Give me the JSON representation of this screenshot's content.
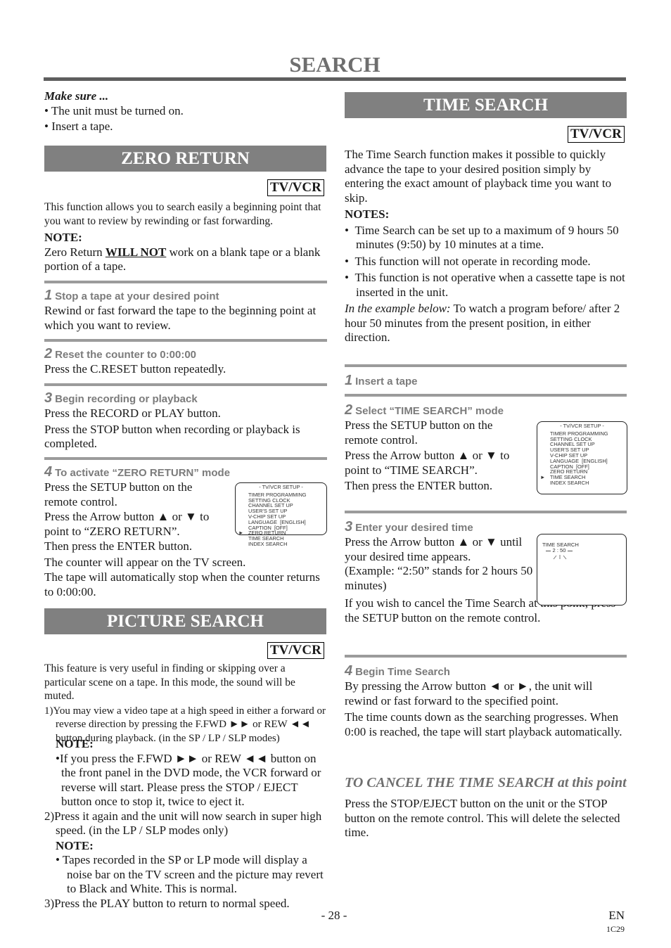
{
  "page": {
    "title": "SEARCH",
    "page_number": "- 28 -",
    "language": "EN",
    "code": "1C29"
  },
  "make_sure": {
    "heading": "Make sure ...",
    "items": [
      "The unit must be turned on.",
      "Insert a tape."
    ]
  },
  "zero_return": {
    "title": "ZERO RETURN",
    "badge": "TV/VCR",
    "intro": "This function allows you to search easily a beginning point that you want to review by rewinding or fast forwarding.",
    "note_label": "NOTE:",
    "note_pre": "Zero Return ",
    "note_emph": "WILL NOT",
    "note_post": " work on a blank tape or a blank portion of a tape.",
    "steps": [
      {
        "num": "1",
        "title": "Stop a tape at your desired point",
        "lines": [
          "Rewind or fast forward the tape to the beginning point at which you want to review."
        ]
      },
      {
        "num": "2",
        "title": "Reset the counter to 0:00:00",
        "lines": [
          "Press the C.RESET button repeatedly."
        ]
      },
      {
        "num": "3",
        "title": "Begin recording or playback",
        "lines": [
          "Press the RECORD or PLAY button.",
          "Press the STOP button when recording or playback is completed."
        ]
      },
      {
        "num": "4",
        "title": "To activate “ZERO RETURN” mode",
        "lines": [
          "Press the SETUP button on the remote control.",
          "Press the Arrow button ▲ or ▼ to point to “ZERO RETURN”.",
          "Then press the ENTER button.",
          "The counter will appear on the TV screen.",
          "The tape will automatically stop when the counter returns to 0:00:00."
        ]
      }
    ],
    "osd": {
      "title": "- TV/VCR SETUP -",
      "items": [
        "TIMER PROGRAMMING",
        "SETTING CLOCK",
        "CHANNEL SET UP",
        "USER'S SET UP",
        "V-CHIP SET UP",
        "LANGUAGE  [ENGLISH]",
        "CAPTION  [OFF]",
        "ZERO RETURN",
        "TIME SEARCH",
        "INDEX SEARCH"
      ],
      "selected": "ZERO RETURN",
      "cursor_glyph": "►"
    }
  },
  "picture_search": {
    "title": "PICTURE SEARCH",
    "badge": "TV/VCR",
    "intro": "This feature is very useful in finding or skipping over a particular scene on a tape. In this mode, the sound will be muted.",
    "item1": "1)You may view a video tape at a high speed in either a forward or reverse direction by pressing the F.FWD ►► or REW ◄◄ button during playback. (in the SP / LP / SLP modes)",
    "note1_label": "NOTE:",
    "note1": "•If you press the F.FWD ►► or REW ◄◄ button on the front panel in the DVD mode, the VCR forward or reverse will start. Please press the STOP / EJECT button once to stop it, twice to eject it.",
    "item2": "2)Press it again and the unit will now search in super high speed. (in the LP / SLP modes only)",
    "note2_label": "NOTE:",
    "note2": "• Tapes recorded in the SP or LP mode will display a noise bar on the TV screen and the picture may revert to Black and White. This is normal.",
    "item3": "3)Press the PLAY button to return to normal speed."
  },
  "time_search": {
    "title": "TIME SEARCH",
    "badge": "TV/VCR",
    "intro": "The Time Search function makes it possible to quickly advance the tape to your desired position simply by entering the exact amount of playback time you want to skip.",
    "notes_label": "NOTES:",
    "notes": [
      "Time Search can be set up to a maximum of 9 hours 50 minutes (9:50) by 10 minutes at a time.",
      "This function will not operate in recording mode.",
      "This function is not operative when a cassette tape is not inserted in the unit."
    ],
    "example_label": "In the example below:",
    "example_text": " To watch a program before/ after 2 hour 50 minutes from the present position, in either direction.",
    "steps": [
      {
        "num": "1",
        "title": "Insert a tape",
        "lines": []
      },
      {
        "num": "2",
        "title": "Select “TIME SEARCH” mode",
        "lines": [
          "Press the SETUP button on the remote control.",
          "Press the Arrow button ▲ or ▼ to point to “TIME SEARCH”.",
          "Then press the ENTER button."
        ]
      },
      {
        "num": "3",
        "title": "Enter your desired time",
        "lines": [
          "Press the Arrow button ▲ or ▼ until your desired time appears.",
          "(Example: “2:50” stands for 2 hours 50 minutes)",
          "If you wish to cancel the Time Search at this point, press the SETUP button on the remote control."
        ]
      },
      {
        "num": "4",
        "title": "Begin Time Search",
        "lines": [
          "By pressing the Arrow button ◄ or ►, the unit will rewind or fast forward to the specified point.",
          "The time counts down as the searching progresses. When 0:00 is reached, the tape will start playback automatically."
        ]
      }
    ],
    "osd": {
      "title": "- TV/VCR SETUP -",
      "items": [
        "TIMER PROGRAMMING",
        "SETTING CLOCK",
        "CHANNEL SET UP",
        "USER'S SET UP",
        "V-CHIP SET UP",
        "LANGUAGE  [ENGLISH]",
        "CAPTION  [OFF]",
        "ZERO RETURN",
        "TIME SEARCH",
        "INDEX SEARCH"
      ],
      "selected": "TIME SEARCH",
      "cursor_glyph": "►"
    },
    "osd_time": {
      "label": "TIME SEARCH",
      "value": "2 : 50"
    },
    "cancel": {
      "heading": "TO CANCEL THE TIME SEARCH at this point",
      "text": "Press the STOP/EJECT button on the unit or the STOP button on the remote control. This will delete the selected time."
    }
  }
}
